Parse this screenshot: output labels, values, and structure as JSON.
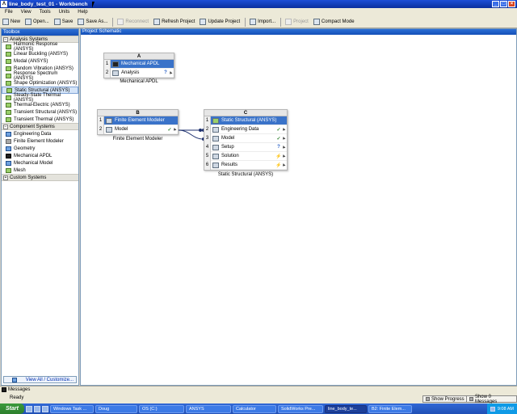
{
  "window": {
    "title": "line_body_test_01 - Workbench"
  },
  "menu": [
    "File",
    "View",
    "Tools",
    "Units",
    "Help"
  ],
  "toolbar": [
    {
      "label": "New",
      "enabled": true
    },
    {
      "label": "Open...",
      "enabled": true
    },
    {
      "label": "Save",
      "enabled": true
    },
    {
      "label": "Save As...",
      "enabled": true
    },
    {
      "label": "Reconnect",
      "enabled": false
    },
    {
      "label": "Refresh Project",
      "enabled": true
    },
    {
      "label": "Update Project",
      "enabled": true
    },
    {
      "label": "Import...",
      "enabled": true
    },
    {
      "label": "Project",
      "enabled": false
    },
    {
      "label": "Compact Mode",
      "enabled": true
    }
  ],
  "toolbox": {
    "title": "Toolbox",
    "groups": [
      {
        "label": "Analysis Systems",
        "items": [
          "Harmonic Response (ANSYS)",
          "Linear Buckling (ANSYS)",
          "Modal (ANSYS)",
          "Random Vibration (ANSYS)",
          "Response Spectrum (ANSYS)",
          "Shape Optimization (ANSYS)",
          "Static Structural (ANSYS)",
          "Steady-State Thermal (ANSYS)",
          "Thermal-Electric (ANSYS)",
          "Transient Structural (ANSYS)",
          "Transient Thermal (ANSYS)"
        ]
      },
      {
        "label": "Component Systems",
        "items": [
          "Engineering Data",
          "Finite Element Modeler",
          "Geometry",
          "Mechanical APDL",
          "Mechanical Model",
          "Mesh"
        ]
      },
      {
        "label": "Custom Systems",
        "items": []
      }
    ],
    "selected": "Static Structural (ANSYS)",
    "view_all": "View All / Customize..."
  },
  "schematic": {
    "title": "Project Schematic",
    "systems": {
      "A": {
        "letter": "A",
        "caption": "Mechanical APDL",
        "rows": [
          {
            "n": "1",
            "label": "Mechanical APDL",
            "status": ""
          },
          {
            "n": "2",
            "label": "Analysis",
            "status": "?"
          }
        ]
      },
      "B": {
        "letter": "B",
        "caption": "Finite Element Modeler",
        "rows": [
          {
            "n": "1",
            "label": "Finite Element Modeler",
            "status": ""
          },
          {
            "n": "2",
            "label": "Model",
            "status": "✓"
          }
        ]
      },
      "C": {
        "letter": "C",
        "caption": "Static Structural (ANSYS)",
        "rows": [
          {
            "n": "1",
            "label": "Static Structural (ANSYS)",
            "status": ""
          },
          {
            "n": "2",
            "label": "Engineering Data",
            "status": "✓"
          },
          {
            "n": "3",
            "label": "Model",
            "status": "✓"
          },
          {
            "n": "4",
            "label": "Setup",
            "status": "?"
          },
          {
            "n": "5",
            "label": "Solution",
            "status": "⚡"
          },
          {
            "n": "6",
            "label": "Results",
            "status": "⚡"
          }
        ]
      }
    }
  },
  "status": {
    "messages": "Messages",
    "ready": "Ready",
    "show_progress": "Show Progress",
    "show_messages": "Show 0 Messages"
  },
  "taskbar": {
    "start": "Start",
    "buttons": [
      "Windows Task ...",
      "Doug",
      "OS (C:)",
      "ANSYS",
      "Calculator",
      "SolidWorks Pre...",
      "line_body_te...",
      "B2: Finite Elem..."
    ],
    "active": "line_body_te...",
    "clock": "9:08 AM"
  }
}
